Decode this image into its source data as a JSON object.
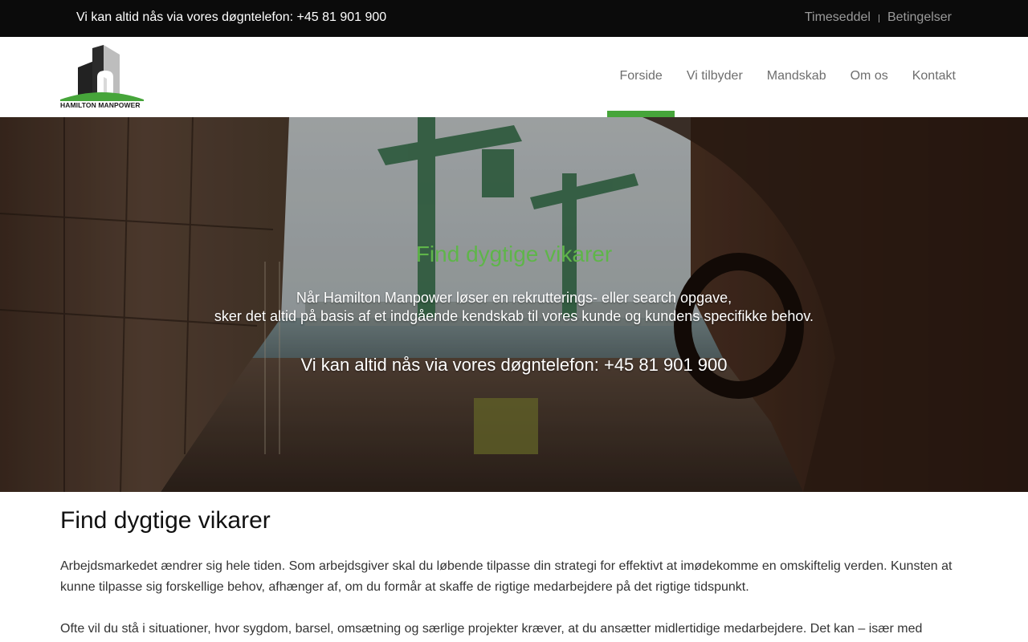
{
  "topbar": {
    "hotline": "Vi kan altid nås via vores døgntelefon: +45 81 901 900",
    "links": [
      "Timeseddel",
      "Betingelser"
    ]
  },
  "logo": {
    "text": "HAMILTON MANPOWER"
  },
  "nav": {
    "items": [
      "Forside",
      "Vi tilbyder",
      "Mandskab",
      "Om os",
      "Kontakt"
    ],
    "active": "Forside"
  },
  "hero": {
    "title": "Find dygtige vikarer",
    "line1": "Når Hamilton Manpower løser en rekrutterings- eller search opgave,",
    "line2": "sker det altid på basis af et indgående kendskab til vores kunde og kundens specifikke behov.",
    "phone": "Vi kan altid nås via vores døgntelefon: +45 81 901 900"
  },
  "content": {
    "heading": "Find dygtige vikarer",
    "paragraph1": "Arbejdsmarkedet ændrer sig hele tiden. Som arbejdsgiver skal du løbende tilpasse din strategi for effektivt at imødekomme en omskiftelig verden. Kunsten at kunne tilpasse sig forskellige behov, afhænger af, om du formår at skaffe de rigtige medarbejdere på det rigtige tidspunkt.",
    "paragraph2": "Ofte vil du stå i situationer, hvor sygdom, barsel, omsætning og særlige projekter kræver, at du ansætter midlertidige medarbejdere. Det kan – især med"
  },
  "colors": {
    "accent": "#46a53a",
    "hero_title": "#5fb54a",
    "topbar_bg": "#0b0b0b",
    "nav_text": "#6e6e6e"
  }
}
